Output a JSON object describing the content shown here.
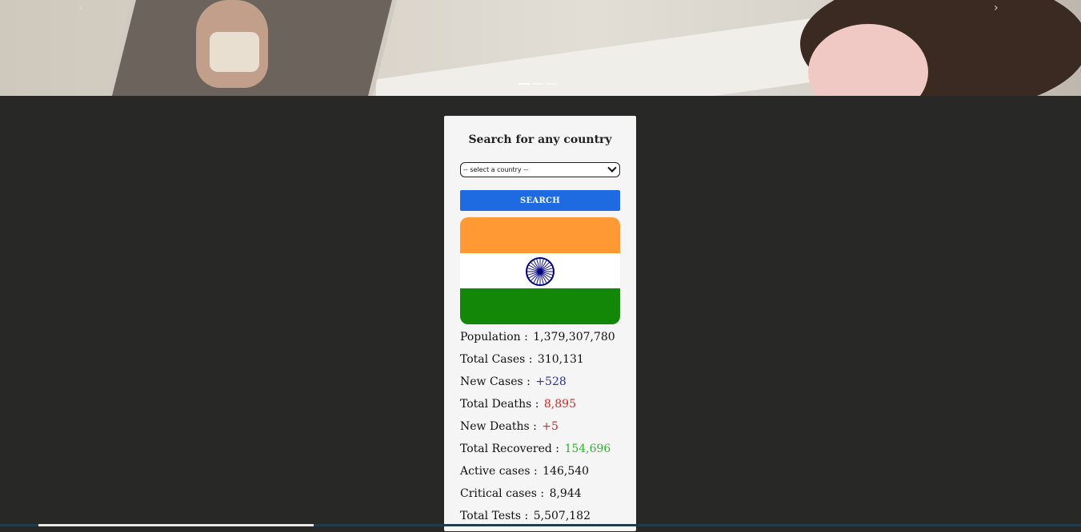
{
  "carousel": {
    "prev_icon": "‹",
    "next_icon": "›",
    "slides_count": 3,
    "active_slide": 1
  },
  "search": {
    "title": "Search for any country",
    "select_value": "-- select a country --",
    "button_label": "SEARCH"
  },
  "country": {
    "flag": "india-flag",
    "colors": {
      "saffron": "#fe9933",
      "white": "#ffffff",
      "green": "#138808",
      "chakra": "#000080"
    }
  },
  "stats": [
    {
      "label": "Population :",
      "value": "1,379,307,780",
      "color": "#111111"
    },
    {
      "label": "Total Cases :",
      "value": "310,131",
      "color": "#111111"
    },
    {
      "label": "New Cases :",
      "value": "+528",
      "color": "#2b2bb8"
    },
    {
      "label": "Total Deaths :",
      "value": "8,895",
      "color": "#e02424"
    },
    {
      "label": "New Deaths :",
      "value": "+5",
      "color": "#e02424"
    },
    {
      "label": "Total Recovered :",
      "value": "154,696",
      "color": "#2db52d"
    },
    {
      "label": "Active cases :",
      "value": "146,540",
      "color": "#111111"
    },
    {
      "label": "Critical cases :",
      "value": "8,944",
      "color": "#111111"
    },
    {
      "label": "Total Tests :",
      "value": "5,507,182",
      "color": "#111111"
    }
  ]
}
